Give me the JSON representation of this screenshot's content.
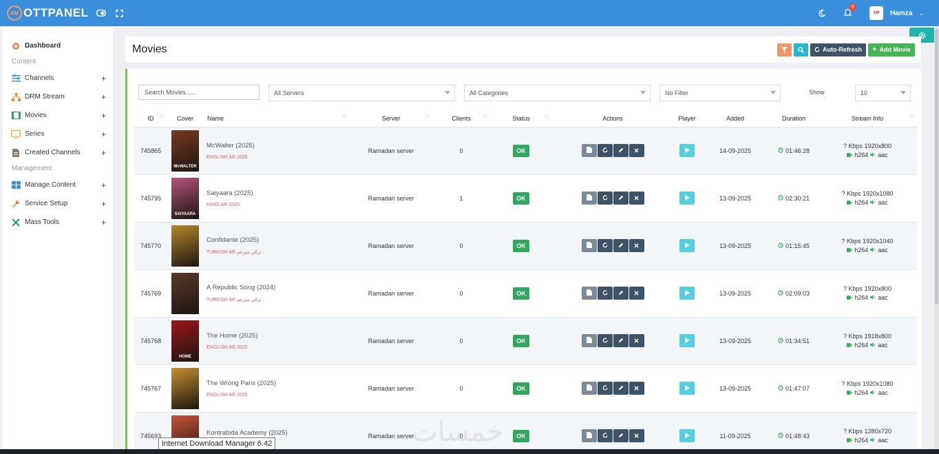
{
  "app": {
    "brand": "OTTPANEL",
    "logo_mark": "XM"
  },
  "topbar": {
    "username": "Hamza",
    "notif_count": "0",
    "avatar_text": "XM"
  },
  "sidebar": {
    "items": [
      {
        "label": "Dashboard",
        "icon": "dashboard-icon",
        "has_plus": false,
        "bold": true
      },
      {
        "section": "Content"
      },
      {
        "label": "Channels",
        "icon": "channels-icon",
        "has_plus": true
      },
      {
        "label": "DRM Stream",
        "icon": "drm-icon",
        "has_plus": true
      },
      {
        "label": "Movies",
        "icon": "movies-icon",
        "has_plus": true
      },
      {
        "label": "Series",
        "icon": "series-icon",
        "has_plus": true
      },
      {
        "label": "Created Channels",
        "icon": "created-channels-icon",
        "has_plus": true
      },
      {
        "section": "Management"
      },
      {
        "label": "Manage Content",
        "icon": "manage-content-icon",
        "has_plus": true
      },
      {
        "label": "Service Setup",
        "icon": "wrench-icon",
        "has_plus": true
      },
      {
        "label": "Mass Tools",
        "icon": "tools-icon",
        "has_plus": true
      }
    ]
  },
  "header": {
    "title": "Movies",
    "auto_refresh": "Auto-Refresh",
    "add_movie": "Add Movie",
    "colors": {
      "filter": "#f4956a",
      "search": "#23b9d1",
      "auto_refresh": "#3e5366",
      "add_movie": "#45b551"
    }
  },
  "filters": {
    "search_placeholder": "Search Movies......",
    "servers": "All Servers",
    "categories": "All Categories",
    "filter": "No Filter",
    "show_label": "Show",
    "show_value": "10"
  },
  "table": {
    "headers": [
      "ID",
      "Cover",
      "Name",
      "Server",
      "Clients",
      "Status",
      "Actions",
      "Player",
      "Added",
      "Duration",
      "Stream Info"
    ],
    "rows": [
      {
        "id": "745865",
        "name": "McWalter (2025)",
        "category": "ENGLISH AR 2025",
        "server": "Ramadan server",
        "clients": "0",
        "status": "OK",
        "added": "14-09-2025",
        "duration": "01:46:28",
        "info1": "? Kbps 1920x800",
        "vcodec": "h264",
        "acodec": "aac",
        "cover_text": "McWALTER",
        "cover_color": "#7a3a22"
      },
      {
        "id": "745795",
        "name": "Saiyaara (2025)",
        "category": "HINDI AR 2025",
        "server": "Ramadan server",
        "clients": "1",
        "status": "OK",
        "added": "13-09-2025",
        "duration": "02:30:21",
        "info1": "? Kbps 1920x1080",
        "vcodec": "h264",
        "acodec": "aac",
        "cover_text": "SAIYAARA",
        "cover_color": "#b2557a"
      },
      {
        "id": "745770",
        "name": "Confidante (2025)",
        "category": "TURKISH AR تركي مترجم",
        "server": "Ramadan server",
        "clients": "0",
        "status": "OK",
        "added": "13-09-2025",
        "duration": "01:15:45",
        "info1": "? Kbps 1920x1040",
        "vcodec": "h264",
        "acodec": "aac",
        "cover_text": "",
        "cover_color": "#b58a2a"
      },
      {
        "id": "745769",
        "name": "A Republic Song (2024)",
        "category": "TURKISH AR تركي مترجم",
        "server": "Ramadan server",
        "clients": "0",
        "status": "OK",
        "added": "13-09-2025",
        "duration": "02:09:03",
        "info1": "? Kbps 1920x800",
        "vcodec": "h264",
        "acodec": "aac",
        "cover_text": "",
        "cover_color": "#5a3a2a"
      },
      {
        "id": "745768",
        "name": "The Home (2025)",
        "category": "ENGLISH AR 2025",
        "server": "Ramadan server",
        "clients": "0",
        "status": "OK",
        "added": "13-09-2025",
        "duration": "01:34:51",
        "info1": "? Kbps 1918x800",
        "vcodec": "h264",
        "acodec": "aac",
        "cover_text": "HOME",
        "cover_color": "#9a1717"
      },
      {
        "id": "745767",
        "name": "The Wrong Paris (2025)",
        "category": "ENGLISH AR 2025",
        "server": "Ramadan server",
        "clients": "0",
        "status": "OK",
        "added": "13-09-2025",
        "duration": "01:47:07",
        "info1": "? Kbps 1920x1080",
        "vcodec": "h264",
        "acodec": "aac",
        "cover_text": "",
        "cover_color": "#c7902f"
      },
      {
        "id": "745693",
        "name": "Kontrabida Academy (2025)",
        "category": "",
        "server": "Ramadan server",
        "clients": "0",
        "status": "OK",
        "added": "11-09-2025",
        "duration": "01:48:43",
        "info1": "? Kbps 1280x720",
        "vcodec": "h264",
        "acodec": "aac",
        "cover_text": "",
        "cover_color": "#c9553a"
      }
    ]
  },
  "tooltip": "Internet Download Manager 6.42",
  "watermark": "خمسات"
}
